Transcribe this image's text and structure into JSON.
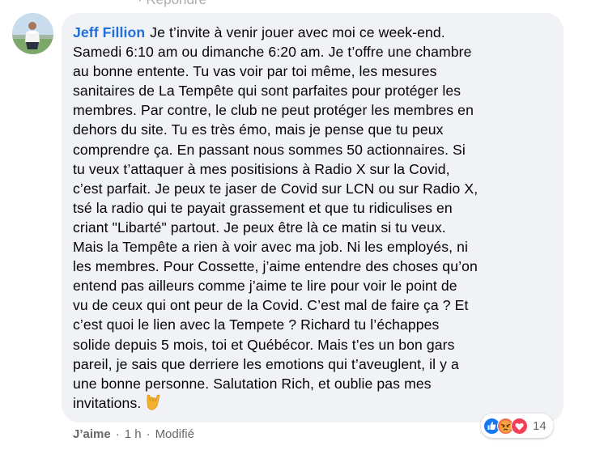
{
  "top_partial_text": "· Répondre",
  "comment": {
    "author": "Jeff Fillion",
    "lines": [
      "Je t’invite à venir jouer avec moi ce week-end.",
      "Samedi 6:10 am ou dimanche 6:20 am. Je t’offre une chambre",
      "au bonne entente. Tu vas voir par toi même, les mesures",
      "sanitaires de La Tempête qui sont parfaites pour protéger les",
      "membres. Par contre, le club ne peut protéger les membres en",
      "dehors du site. Tu es très émo, mais je pense que tu peux",
      "comprendre ça. En passant nous sommes 50 actionnaires. Si",
      "tu veux t’attaquer à mes positisions à Radio X sur la Covid,",
      "c’est parfait. Je peux te jaser de Covid sur LCN ou sur Radio X,",
      "tsé la radio qui te payait grassement et que tu ridiculises en",
      "criant \"Libarté\" partout. Je peux être là ce matin si tu veux.",
      "Mais la Tempête a rien à voir avec ma job. Ni les employés, ni",
      "les membres. Pour Cossette, j’aime entendre des choses qu’on",
      "entend pas ailleurs comme j’aime te lire pour voir le point de",
      "vu de ceux qui ont peur de la Covid. C’est mal de faire ça ? Et",
      "c’est quoi le lien avec la Tempete ? Richard tu l’échappes",
      "solide depuis 5 mois, toi et Québécor. Mais t’es un bon gars",
      "pareil, je sais que derriere les emotions qui t’aveuglent, il y a",
      "une bonne personne. Salutation Rich, et oublie pas mes",
      "invitations."
    ],
    "end_emoji": "love-you-gesture-emoji"
  },
  "actions": {
    "like": "J’aime",
    "separator": "·",
    "time": "1 h",
    "edited": "Modifié"
  },
  "reactions": {
    "icons": [
      "like-reaction-icon",
      "angry-reaction-icon",
      "love-reaction-icon"
    ],
    "count": "14"
  },
  "colors": {
    "author": "#216fdb",
    "bubble": "#f0f2f5",
    "muted": "#65676b",
    "like": "#1877f2",
    "angry": "#f2714c",
    "love": "#f33e58"
  }
}
